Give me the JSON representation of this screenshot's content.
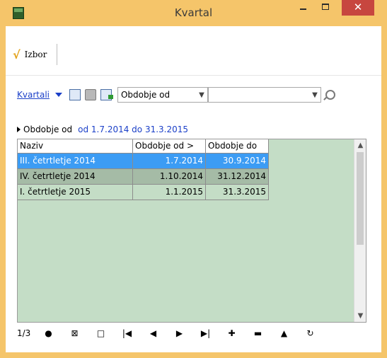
{
  "window": {
    "title": "Kvartal",
    "minimize_label": "–",
    "maximize_label": "□",
    "close_label": "✕"
  },
  "toolbar": {
    "check_glyph": "√",
    "izbor_label": "Izbor"
  },
  "view": {
    "selector_label": "Kvartali",
    "filter_field": "Obdobje od",
    "search_value": ""
  },
  "filter": {
    "label": "Obdobje od",
    "value": "od 1.7.2014 do 31.3.2015"
  },
  "grid": {
    "columns": [
      "Naziv",
      "Obdobje od  >",
      "Obdobje do"
    ],
    "rows": [
      {
        "naziv": "III. četrtletje  2014",
        "od": "1.7.2014",
        "do": "30.9.2014",
        "state": "selected"
      },
      {
        "naziv": "IV. četrtletje  2014",
        "od": "1.10.2014",
        "do": "31.12.2014",
        "state": "alt"
      },
      {
        "naziv": "I. četrtletje  2015",
        "od": "1.1.2015",
        "do": "31.3.2015",
        "state": "normal"
      }
    ]
  },
  "navigator": {
    "position": "1/3",
    "buttons": [
      "●",
      "⊠",
      "□",
      "|◀",
      "◀",
      "▶",
      "▶|",
      "✚",
      "▬",
      "▲",
      "↻"
    ]
  },
  "colors": {
    "titlebar": "#f5c56a",
    "close": "#c7463f",
    "selected_row": "#3c9cf4",
    "grid_bg": "#c4ddc6",
    "link": "#1a3fc8"
  }
}
